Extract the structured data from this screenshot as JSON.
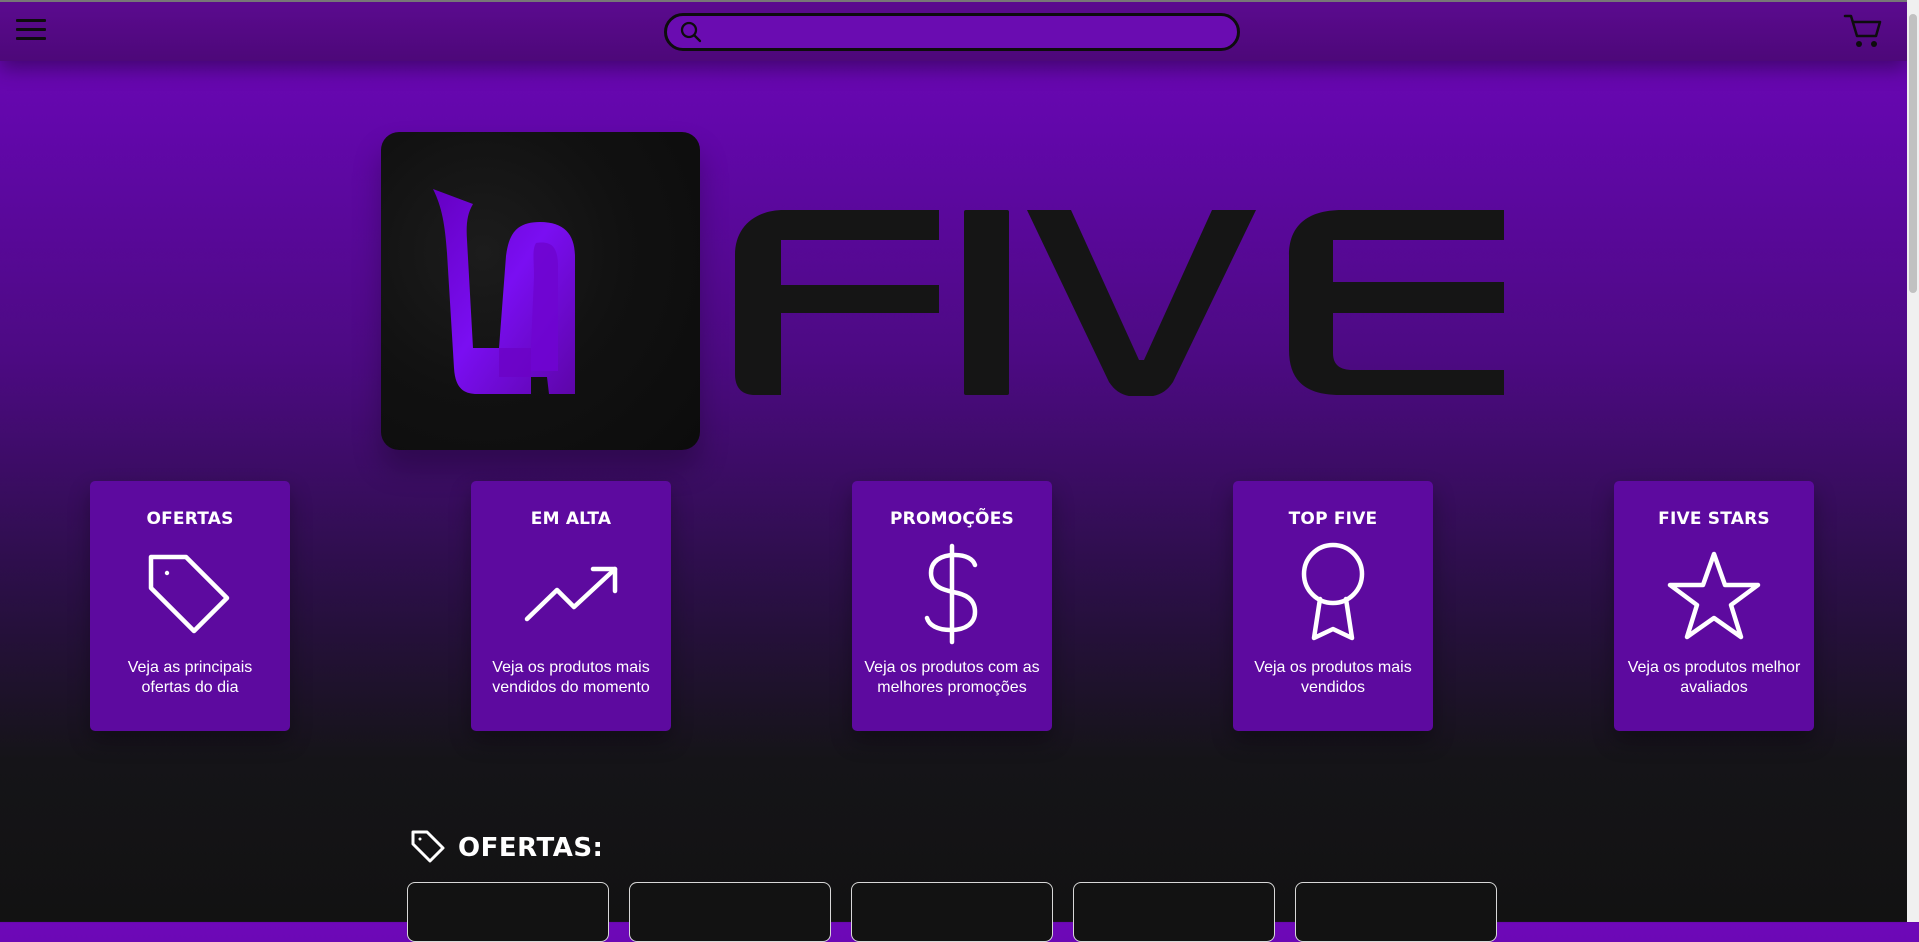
{
  "header": {
    "search_placeholder": ""
  },
  "logo": {
    "brand": "FIVE"
  },
  "categories": [
    {
      "title": "OFERTAS",
      "description": "Veja as principais ofertas do dia",
      "icon": "tag-icon"
    },
    {
      "title": "EM ALTA",
      "description": "Veja os produtos mais vendidos do momento",
      "icon": "trending-up-icon"
    },
    {
      "title": "PROMOÇÕES",
      "description": "Veja os produtos com as melhores promoções",
      "icon": "dollar-icon"
    },
    {
      "title": "TOP FIVE",
      "description": "Veja os produtos mais vendidos",
      "icon": "award-icon"
    },
    {
      "title": "FIVE STARS",
      "description": "Veja os produtos melhor avaliados",
      "icon": "star-icon"
    }
  ],
  "offers_section": {
    "title": "OFERTAS:",
    "icon": "tag-icon"
  },
  "colors": {
    "accent": "#6a0cb1",
    "card": "#5d0a9f",
    "header": "#5b0a8f",
    "dark": "#121212"
  }
}
